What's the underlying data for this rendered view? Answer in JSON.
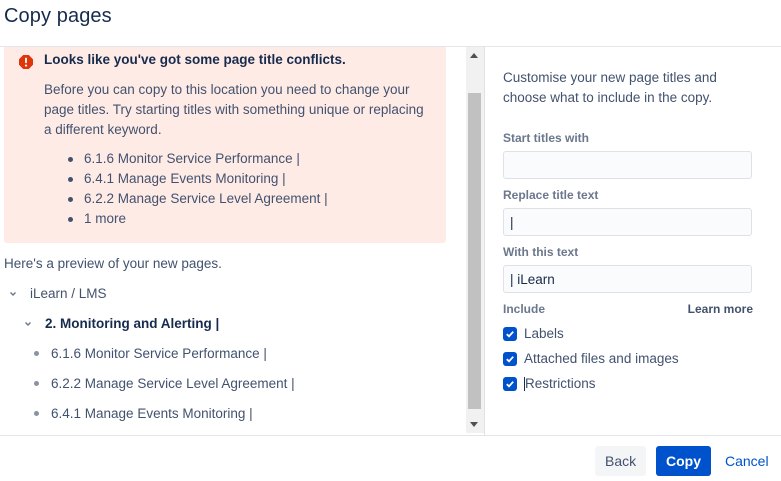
{
  "dialog": {
    "title": "Copy pages"
  },
  "alert": {
    "title": "Looks like you've got some page title conflicts.",
    "body": "Before you can copy to this location you need to change your page titles. Try starting titles with something unique or replacing a different keyword.",
    "conflicts": [
      "6.1.6 Monitor Service Performance |",
      "6.4.1 Manage Events Monitoring |",
      "6.2.2 Manage Service Level Agreement |",
      "1 more"
    ],
    "icon": "error-icon",
    "color": "#de350b"
  },
  "preview": {
    "label": "Here's a preview of your new pages.",
    "space": "iLearn / LMS",
    "parent": "2. Monitoring and Alerting |",
    "children": [
      "6.1.6 Monitor Service Performance |",
      "6.2.2 Manage Service Level Agreement |",
      "6.4.1 Manage Events Monitoring |"
    ]
  },
  "options": {
    "intro": "Customise your new page titles and choose what to include in the copy.",
    "start_titles_label": "Start titles with",
    "start_titles_value": "",
    "replace_label": "Replace title text",
    "replace_value": "|",
    "with_label": "With this text",
    "with_value": "| iLearn",
    "include_label": "Include",
    "learn_more": "Learn more",
    "include": [
      {
        "label": "Labels",
        "checked": true
      },
      {
        "label": "Attached files and images",
        "checked": true
      },
      {
        "label": "Restrictions",
        "checked": true
      }
    ]
  },
  "footer": {
    "back": "Back",
    "copy": "Copy",
    "cancel": "Cancel"
  },
  "colors": {
    "primary": "#0052cc",
    "alert_bg": "#ffebe6",
    "text": "#172b4d"
  }
}
